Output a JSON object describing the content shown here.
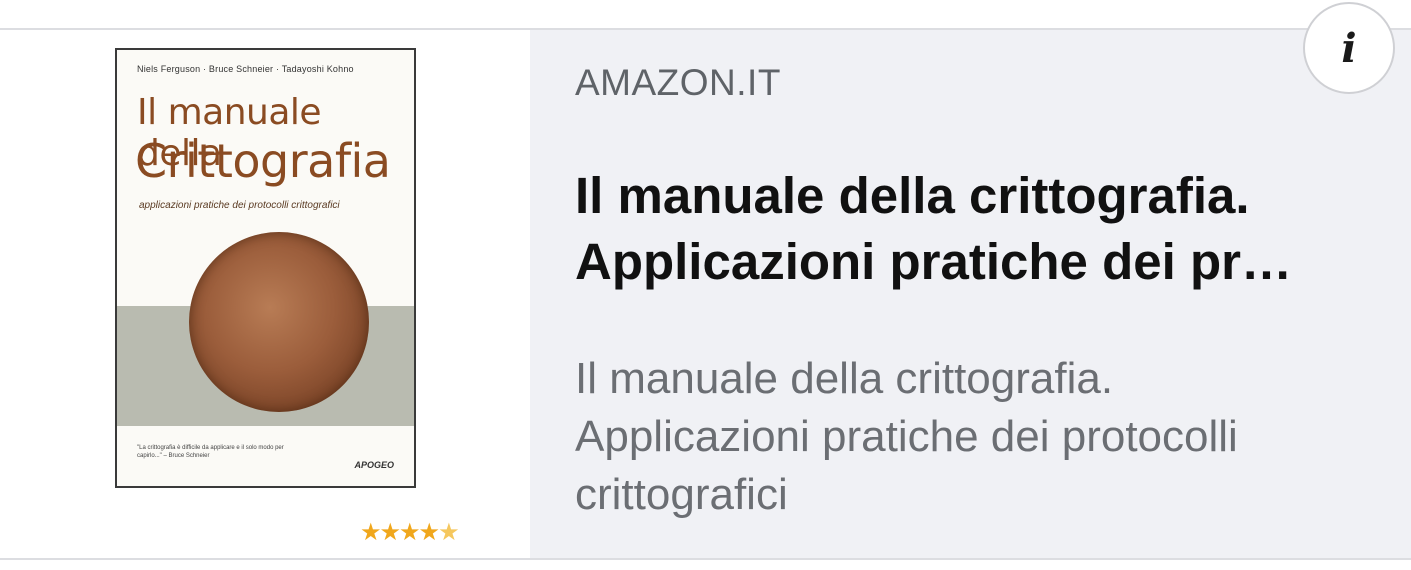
{
  "card": {
    "source": "AMAZON.IT",
    "title_line1": "Il manuale della crittografia.",
    "title_line2": "Applicazioni pratiche dei pr…",
    "description_line1": "Il manuale della crittografia.",
    "description_line2": "Applicazioni pratiche dei protocolli",
    "description_line3": "crittografici",
    "info_icon": "info-icon",
    "info_glyph": "i",
    "rating": 4.5,
    "rating_stars": "★★★★",
    "rating_half": "★"
  },
  "book_cover": {
    "authors": "Niels Ferguson · Bruce Schneier · Tadayoshi Kohno",
    "title_line1": "Il manuale della",
    "title_line2": "Crittografia",
    "subtitle": "applicazioni pratiche dei protocolli crittografici",
    "quote": "\"La crittografia è difficile da applicare e il solo modo per capirlo...\" – Bruce Schneier",
    "publisher": "APOGEO"
  },
  "colors": {
    "text_pane_bg": "#f0f1f5",
    "star": "#f0a71c",
    "cover_title": "#8a4b22"
  }
}
